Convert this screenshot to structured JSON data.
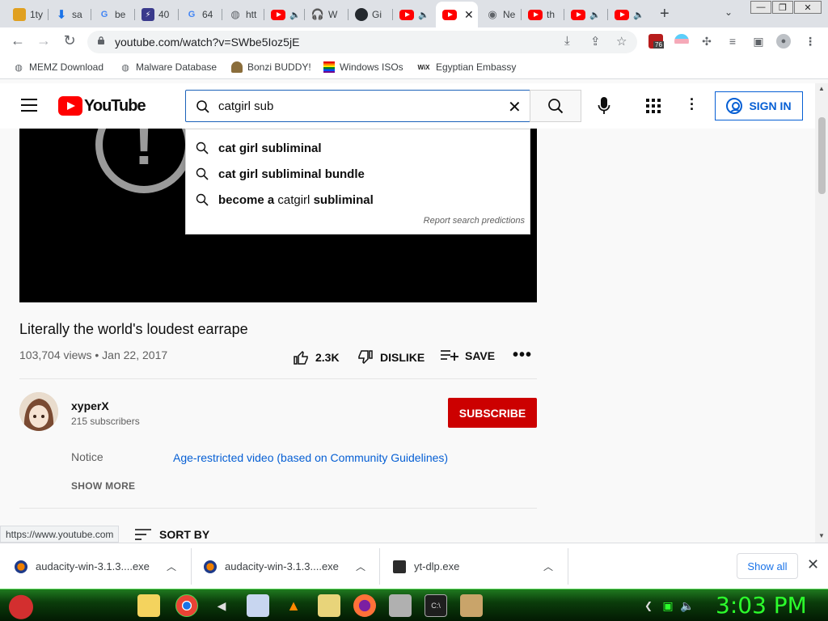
{
  "window": {
    "tabs": [
      {
        "label": "1ty",
        "favicon": "doc-icon",
        "color": "#e0a020"
      },
      {
        "label": "sa",
        "favicon": "download-icon",
        "color": "#1a73e8"
      },
      {
        "label": "be",
        "favicon": "google-icon",
        "color": "#4285f4"
      },
      {
        "label": "40",
        "favicon": "lightning-icon",
        "color": "#3a3a8c"
      },
      {
        "label": "64",
        "favicon": "google-icon",
        "color": "#4285f4"
      },
      {
        "label": "htt",
        "favicon": "globe-icon",
        "color": "#5f6368"
      },
      {
        "label": "",
        "favicon": "youtube-icon",
        "color": "#ff0000"
      },
      {
        "label": "W",
        "favicon": "audacity-icon",
        "color": "#f08000"
      },
      {
        "label": "Gi",
        "favicon": "github-icon",
        "color": "#24292e"
      },
      {
        "label": "",
        "favicon": "youtube-icon",
        "color": "#ff0000"
      },
      {
        "label": "",
        "favicon": "youtube-icon",
        "color": "#ff0000"
      },
      {
        "label": "Ne",
        "favicon": "chrome-icon",
        "color": "#5f6368"
      },
      {
        "label": "th",
        "favicon": "youtube-icon",
        "color": "#ff0000"
      },
      {
        "label": "",
        "favicon": "youtube-icon",
        "color": "#ff0000"
      },
      {
        "label": "",
        "favicon": "youtube-icon",
        "color": "#ff0000"
      }
    ],
    "new_tab": "+"
  },
  "address_bar": {
    "url": "youtube.com/watch?v=SWbe5Ioz5jE",
    "extension_badge": "76"
  },
  "bookmarks": [
    {
      "label": "MEMZ Download",
      "icon": "globe-icon"
    },
    {
      "label": "Malware Database",
      "icon": "globe-icon"
    },
    {
      "label": "Bonzi BUDDY!",
      "icon": "bonzi-icon"
    },
    {
      "label": "Windows ISOs",
      "icon": "windows-icon"
    },
    {
      "label": "Egyptian Embassy",
      "icon": "wix-icon"
    }
  ],
  "youtube": {
    "logo_text": "YouTube",
    "search_value": "catgirl sub",
    "sign_in": "SIGN IN",
    "suggestions": [
      {
        "bold_before": "",
        "normal": "",
        "bold_after": "cat girl subliminal"
      },
      {
        "bold_before": "",
        "normal": "",
        "bold_after": "cat girl subliminal bundle"
      },
      {
        "bold_before": "become a ",
        "normal": "catgirl ",
        "bold_after": "subliminal"
      }
    ],
    "report_predictions": "Report search predictions",
    "video": {
      "title": "Literally the world's loudest earrape",
      "meta": "103,704 views • Jan 22, 2017",
      "likes": "2.3K",
      "dislike": "DISLIKE",
      "save": "SAVE",
      "more": "•••"
    },
    "channel": {
      "name": "xyperX",
      "subscribers": "215 subscribers",
      "subscribe": "SUBSCRIBE"
    },
    "notice_label": "Notice",
    "notice_value": "Age-restricted video (based on Community Guidelines)",
    "show_more": "SHOW MORE",
    "sort_by": "SORT BY",
    "accent": "#065fd4",
    "red": "#cc0000"
  },
  "status_url": "https://www.youtube.com",
  "downloads": {
    "items": [
      {
        "name": "audacity-win-3.1.3....exe",
        "icon": "audacity-icon"
      },
      {
        "name": "audacity-win-3.1.3....exe",
        "icon": "audacity-icon"
      },
      {
        "name": "yt-dlp.exe",
        "icon": "terminal-icon"
      }
    ],
    "show_all": "Show all"
  },
  "taskbar": {
    "clock": "3:03 PM"
  }
}
